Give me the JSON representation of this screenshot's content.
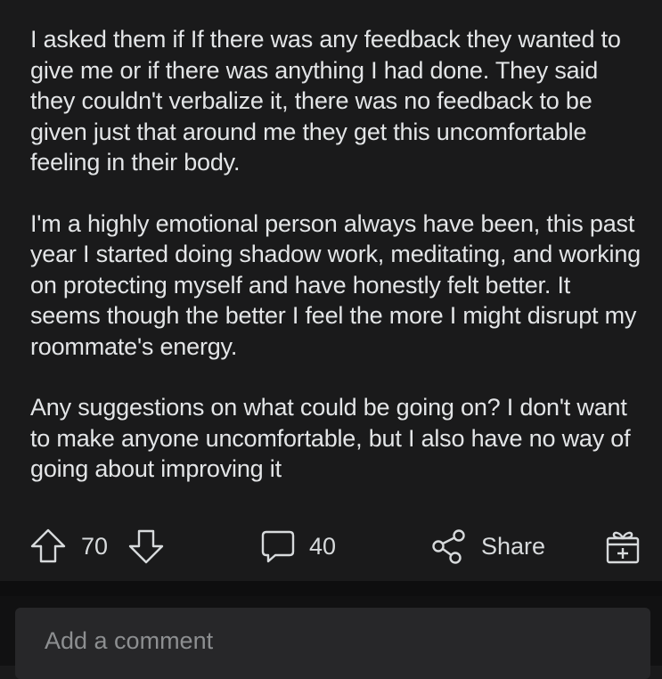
{
  "post": {
    "paragraphs": [
      "I asked them if If there was any feedback they wanted to give me or if there was anything I had done. They said they couldn't verbalize it, there was no feedback to be given just that around me they get this uncomfortable feeling in their body.",
      "I'm a highly emotional person always have been, this past year I started doing shadow work, meditating, and working on protecting myself and have honestly felt better. It seems though the better I feel the more I might disrupt my roommate's energy.",
      "Any suggestions on what could be going on? I don't want to make anyone uncomfortable, but I also have no way of going about improving it"
    ]
  },
  "actions": {
    "vote_count": "70",
    "comment_count": "40",
    "share_label": "Share",
    "icons": {
      "upvote": "upvote-arrow-icon",
      "downvote": "downvote-arrow-icon",
      "comments": "comment-bubble-icon",
      "share": "share-icon",
      "award": "award-gift-icon"
    }
  },
  "comment": {
    "placeholder": "Add a comment"
  },
  "colors": {
    "background": "#1a1a1b",
    "text": "#e3e5e7",
    "muted": "#8d8f91",
    "input_bg": "#272729"
  }
}
